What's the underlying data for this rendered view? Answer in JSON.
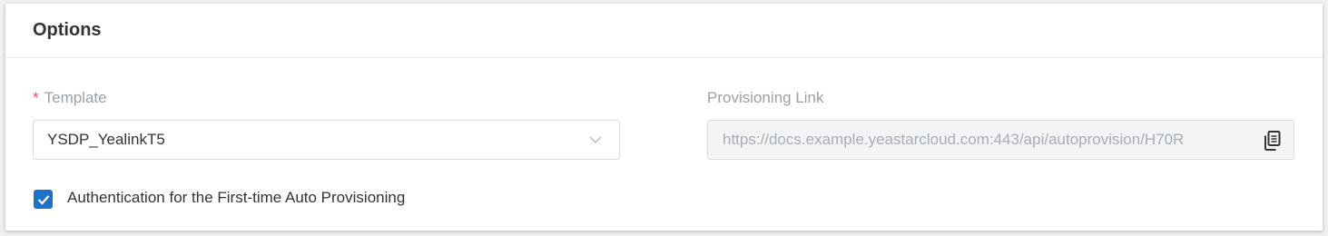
{
  "section": {
    "title": "Options"
  },
  "template_field": {
    "required_mark": "*",
    "label": "Template",
    "value": "YSDP_YealinkT5",
    "chevron_icon": "chevron-down-icon"
  },
  "provisioning_field": {
    "label": "Provisioning Link",
    "value": "https://docs.example.yeastarcloud.com:443/api/autoprovision/H70R",
    "copy_icon": "copy-icon"
  },
  "auth_option": {
    "checked": true,
    "label": "Authentication for the First-time Auto Provisioning"
  },
  "colors": {
    "accent": "#1a73c9",
    "required": "#e9505a",
    "label": "#9ba0a8",
    "text": "#333333",
    "disabled_bg": "#f3f4f6"
  }
}
